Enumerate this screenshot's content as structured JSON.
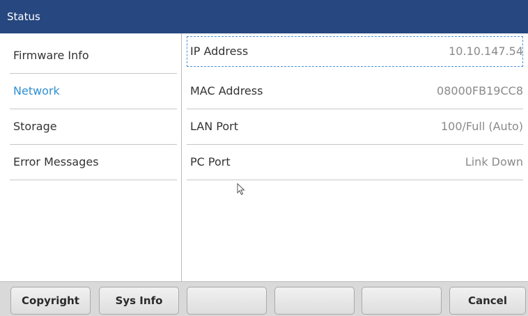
{
  "header": {
    "title": "Status"
  },
  "sidebar": {
    "items": [
      {
        "label": "Firmware Info"
      },
      {
        "label": "Network"
      },
      {
        "label": "Storage"
      },
      {
        "label": "Error Messages"
      }
    ],
    "selected": "Network"
  },
  "network": {
    "rows": [
      {
        "label": "IP Address",
        "value": "10.10.147.54"
      },
      {
        "label": "MAC Address",
        "value": "08000FB19CC8"
      },
      {
        "label": "LAN Port",
        "value": "100/Full (Auto)"
      },
      {
        "label": "PC Port",
        "value": "Link Down"
      }
    ]
  },
  "softkeys": [
    {
      "label": "Copyright"
    },
    {
      "label": "Sys Info"
    },
    {
      "label": ""
    },
    {
      "label": ""
    },
    {
      "label": ""
    },
    {
      "label": "Cancel"
    }
  ],
  "colors": {
    "titlebar": "#26477f",
    "active_item": "#2f8fd0",
    "focus_outline": "#4a8fd8"
  }
}
